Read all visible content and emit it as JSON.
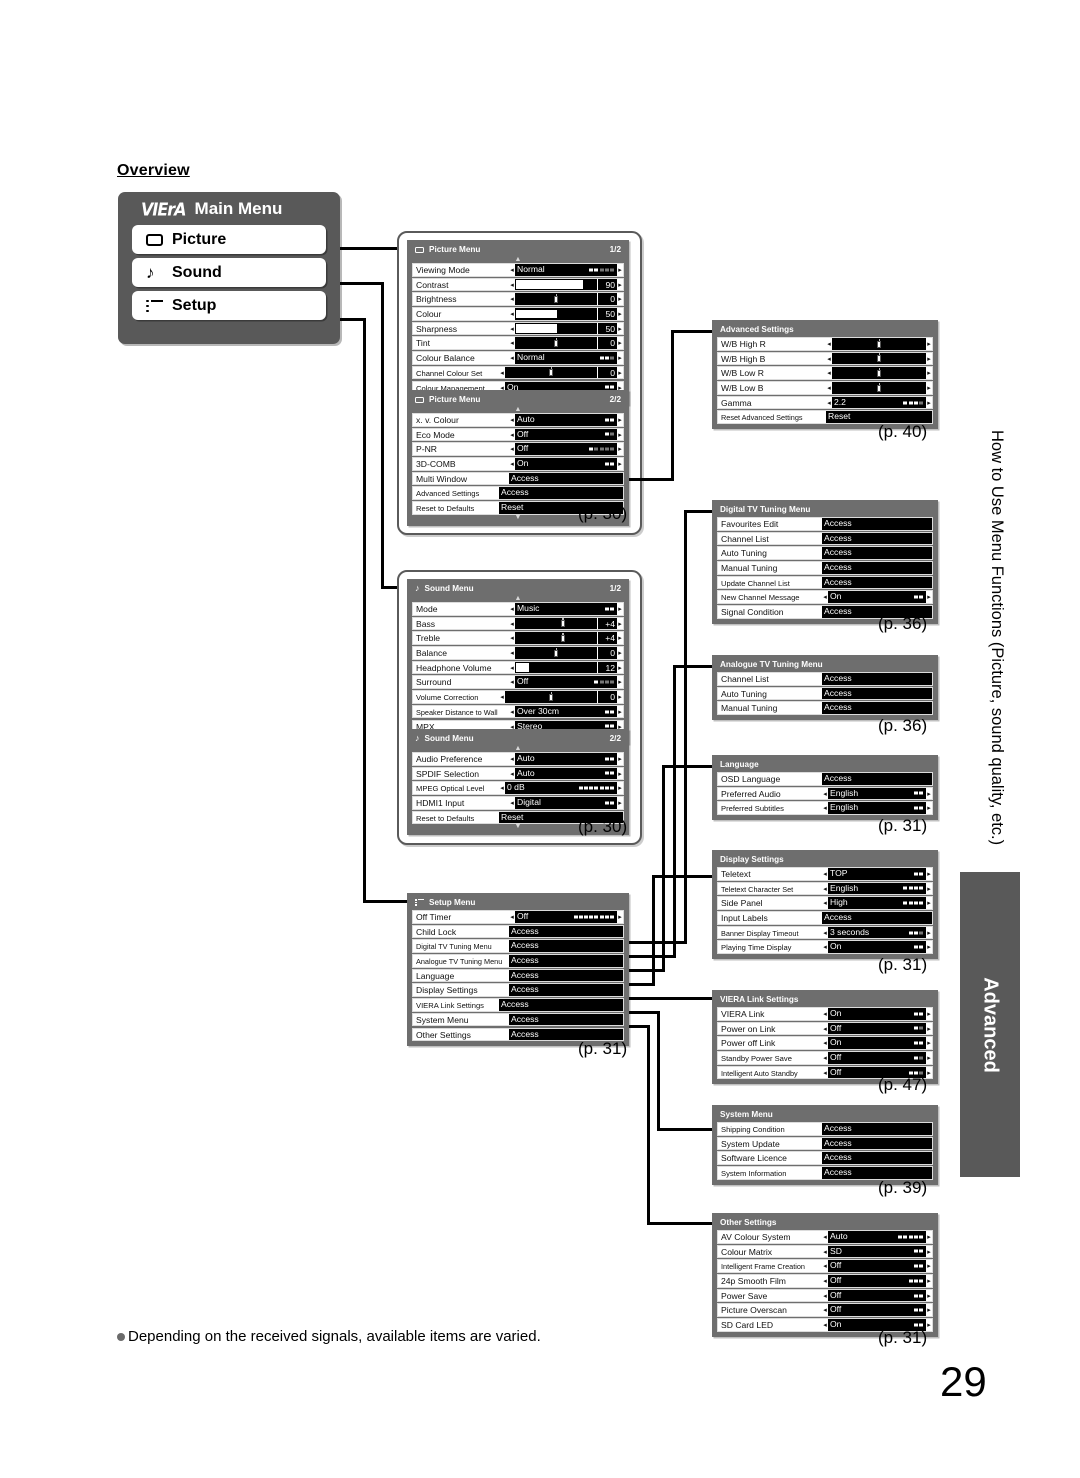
{
  "heading": "Overview",
  "main_menu": {
    "logo": "VIErA",
    "title": "Main Menu",
    "items": [
      {
        "label": "Picture",
        "icon": "picture-icon"
      },
      {
        "label": "Sound",
        "icon": "music-note-icon"
      },
      {
        "label": "Setup",
        "icon": "list-icon"
      }
    ]
  },
  "panels": {
    "picture1": {
      "title": "Picture Menu",
      "page": "1/2",
      "icon": "picture-icon",
      "rows": [
        {
          "label": "Viewing Mode",
          "value": "Normal",
          "type": "option",
          "dots": 5,
          "on": 2
        },
        {
          "label": "Contrast",
          "value": "90",
          "type": "slider",
          "fill": 82
        },
        {
          "label": "Brightness",
          "value": "0",
          "type": "slider",
          "knob": 50
        },
        {
          "label": "Colour",
          "value": "50",
          "type": "slider",
          "fill": 50
        },
        {
          "label": "Sharpness",
          "value": "50",
          "type": "slider",
          "fill": 50
        },
        {
          "label": "Tint",
          "value": "0",
          "type": "slider",
          "knob": 50
        },
        {
          "label": "Colour Balance",
          "value": "Normal",
          "type": "option",
          "dots": 3,
          "on": 2
        },
        {
          "label": "Channel Colour Set",
          "value": "0",
          "type": "slider",
          "knob": 50
        },
        {
          "label": "Colour Management",
          "value": "On",
          "type": "option",
          "dots": 2,
          "on": 2
        }
      ]
    },
    "picture2": {
      "title": "Picture Menu",
      "page": "2/2",
      "icon": "picture-icon",
      "rows": [
        {
          "label": "x. v. Colour",
          "value": "Auto",
          "type": "option",
          "dots": 2,
          "on": 2
        },
        {
          "label": "Eco Mode",
          "value": "Off",
          "type": "option",
          "dots": 2,
          "on": 1
        },
        {
          "label": "P-NR",
          "value": "Off",
          "type": "option",
          "dots": 5,
          "on": 1
        },
        {
          "label": "3D-COMB",
          "value": "On",
          "type": "option",
          "dots": 2,
          "on": 2
        },
        {
          "label": "Multi Window",
          "value": "Access",
          "type": "access"
        },
        {
          "label": "Advanced Settings",
          "value": "Access",
          "type": "access"
        },
        {
          "label": "Reset to Defaults",
          "value": "Reset",
          "type": "access"
        }
      ]
    },
    "sound1": {
      "title": "Sound Menu",
      "page": "1/2",
      "icon": "music-note-icon",
      "rows": [
        {
          "label": "Mode",
          "value": "Music",
          "type": "option",
          "dots": 2,
          "on": 2
        },
        {
          "label": "Bass",
          "value": "+4",
          "type": "slider",
          "knob": 58
        },
        {
          "label": "Treble",
          "value": "+4",
          "type": "slider",
          "knob": 58
        },
        {
          "label": "Balance",
          "value": "0",
          "type": "slider",
          "knob": 50
        },
        {
          "label": "Headphone Volume",
          "value": "12",
          "type": "slider",
          "fill": 16
        },
        {
          "label": "Surround",
          "value": "Off",
          "type": "option",
          "dots": 4,
          "on": 1
        },
        {
          "label": "Volume Correction",
          "value": "0",
          "type": "slider",
          "knob": 50
        },
        {
          "label": "Speaker Distance to Wall",
          "value": "Over 30cm",
          "type": "option",
          "dots": 2,
          "on": 2
        },
        {
          "label": "MPX",
          "value": "Stereo",
          "type": "option",
          "dots": 2,
          "on": 2
        }
      ]
    },
    "sound2": {
      "title": "Sound Menu",
      "page": "2/2",
      "icon": "music-note-icon",
      "rows": [
        {
          "label": "Audio Preference",
          "value": "Auto",
          "type": "option",
          "dots": 2,
          "on": 2
        },
        {
          "label": "SPDIF Selection",
          "value": "Auto",
          "type": "option",
          "dots": 2,
          "on": 2
        },
        {
          "label": "MPEG Optical Level",
          "value": "0 dB",
          "type": "option",
          "dots": 7,
          "on": 7
        },
        {
          "label": "HDMI1 Input",
          "value": "Digital",
          "type": "option",
          "dots": 2,
          "on": 2
        },
        {
          "label": "Reset to Defaults",
          "value": "Reset",
          "type": "access"
        }
      ]
    },
    "setup": {
      "title": "Setup Menu",
      "page": "",
      "icon": "list-icon",
      "rows": [
        {
          "label": "Off Timer",
          "value": "Off",
          "type": "option",
          "dots": 8,
          "on": 8
        },
        {
          "label": "Child Lock",
          "value": "Access",
          "type": "access"
        },
        {
          "label": "Digital TV Tuning Menu",
          "value": "Access",
          "type": "access"
        },
        {
          "label": "Analogue TV Tuning Menu",
          "value": "Access",
          "type": "access"
        },
        {
          "label": "Language",
          "value": "Access",
          "type": "access"
        },
        {
          "label": "Display Settings",
          "value": "Access",
          "type": "access"
        },
        {
          "label": "VIERA Link Settings",
          "value": "Access",
          "type": "access"
        },
        {
          "label": "System Menu",
          "value": "Access",
          "type": "access"
        },
        {
          "label": "Other Settings",
          "value": "Access",
          "type": "access"
        }
      ]
    },
    "advanced": {
      "title": "Advanced Settings",
      "page": "",
      "rows": [
        {
          "label": "W/B High R",
          "value": "",
          "type": "slider",
          "knob": 50
        },
        {
          "label": "W/B High B",
          "value": "",
          "type": "slider",
          "knob": 50
        },
        {
          "label": "W/B Low R",
          "value": "",
          "type": "slider",
          "knob": 50
        },
        {
          "label": "W/B Low B",
          "value": "",
          "type": "slider",
          "knob": 50
        },
        {
          "label": "Gamma",
          "value": "2.2",
          "type": "option",
          "dots": 4,
          "on": 3
        },
        {
          "label": "Reset Advanced Settings",
          "value": "Reset",
          "type": "access"
        }
      ]
    },
    "digital_tuning": {
      "title": "Digital TV Tuning Menu",
      "page": "",
      "rows": [
        {
          "label": "Favourites Edit",
          "value": "Access",
          "type": "access"
        },
        {
          "label": "Channel List",
          "value": "Access",
          "type": "access"
        },
        {
          "label": "Auto Tuning",
          "value": "Access",
          "type": "access"
        },
        {
          "label": "Manual Tuning",
          "value": "Access",
          "type": "access"
        },
        {
          "label": "Update Channel List",
          "value": "Access",
          "type": "access"
        },
        {
          "label": "New Channel Message",
          "value": "On",
          "type": "option",
          "dots": 2,
          "on": 2
        },
        {
          "label": "Signal Condition",
          "value": "Access",
          "type": "access"
        }
      ]
    },
    "analogue_tuning": {
      "title": "Analogue TV Tuning Menu",
      "page": "",
      "rows": [
        {
          "label": "Channel List",
          "value": "Access",
          "type": "access"
        },
        {
          "label": "Auto Tuning",
          "value": "Access",
          "type": "access"
        },
        {
          "label": "Manual Tuning",
          "value": "Access",
          "type": "access"
        }
      ]
    },
    "language": {
      "title": "Language",
      "page": "",
      "rows": [
        {
          "label": "OSD Language",
          "value": "Access",
          "type": "access"
        },
        {
          "label": "Preferred Audio",
          "value": "English",
          "type": "option",
          "dots": 2,
          "on": 2
        },
        {
          "label": "Preferred Subtitles",
          "value": "English",
          "type": "option",
          "dots": 2,
          "on": 2
        }
      ]
    },
    "display": {
      "title": "Display Settings",
      "page": "",
      "rows": [
        {
          "label": "Teletext",
          "value": "TOP",
          "type": "option",
          "dots": 2,
          "on": 2
        },
        {
          "label": "Teletext Character Set",
          "value": "English",
          "type": "option",
          "dots": 4,
          "on": 4
        },
        {
          "label": "Side Panel",
          "value": "High",
          "type": "option",
          "dots": 4,
          "on": 4
        },
        {
          "label": "Input Labels",
          "value": "Access",
          "type": "access"
        },
        {
          "label": "Banner Display Timeout",
          "value": "3 seconds",
          "type": "option",
          "dots": 3,
          "on": 2
        },
        {
          "label": "Playing Time Display",
          "value": "On",
          "type": "option",
          "dots": 2,
          "on": 2
        }
      ]
    },
    "viera_link": {
      "title": "VIERA Link Settings",
      "page": "",
      "rows": [
        {
          "label": "VIERA Link",
          "value": "On",
          "type": "option",
          "dots": 2,
          "on": 2
        },
        {
          "label": "Power on Link",
          "value": "Off",
          "type": "option",
          "dots": 2,
          "on": 1
        },
        {
          "label": "Power off Link",
          "value": "On",
          "type": "option",
          "dots": 2,
          "on": 2
        },
        {
          "label": "Standby Power Save",
          "value": "Off",
          "type": "option",
          "dots": 2,
          "on": 1
        },
        {
          "label": "Intelligent Auto Standby",
          "value": "Off",
          "type": "option",
          "dots": 3,
          "on": 2
        }
      ]
    },
    "system": {
      "title": "System Menu",
      "page": "",
      "rows": [
        {
          "label": "Shipping Condition",
          "value": "Access",
          "type": "access"
        },
        {
          "label": "System Update",
          "value": "Access",
          "type": "access"
        },
        {
          "label": "Software Licence",
          "value": "Access",
          "type": "access"
        },
        {
          "label": "System Information",
          "value": "Access",
          "type": "access"
        }
      ]
    },
    "other": {
      "title": "Other Settings",
      "page": "",
      "rows": [
        {
          "label": "AV Colour System",
          "value": "Auto",
          "type": "option",
          "dots": 5,
          "on": 5
        },
        {
          "label": "Colour Matrix",
          "value": "SD",
          "type": "option",
          "dots": 2,
          "on": 2
        },
        {
          "label": "Intelligent Frame Creation",
          "value": "Off",
          "type": "option",
          "dots": 2,
          "on": 2
        },
        {
          "label": "24p Smooth Film",
          "value": "Off",
          "type": "option",
          "dots": 3,
          "on": 3
        },
        {
          "label": "Power Save",
          "value": "Off",
          "type": "option",
          "dots": 2,
          "on": 2
        },
        {
          "label": "Picture Overscan",
          "value": "Off",
          "type": "option",
          "dots": 2,
          "on": 2
        },
        {
          "label": "SD Card LED",
          "value": "On",
          "type": "option",
          "dots": 2,
          "on": 2
        }
      ]
    }
  },
  "page_refs": {
    "picture": "(p. 30)",
    "sound": "(p. 30)",
    "setup": "(p. 31)",
    "advanced": "(p. 40)",
    "digital_tuning": "(p. 36)",
    "analogue_tuning": "(p. 36)",
    "language": "(p. 31)",
    "display": "(p. 31)",
    "viera_link": "(p. 47)",
    "system": "(p. 39)",
    "other": "(p. 31)"
  },
  "sidebar": {
    "vertical_text": "How to Use Menu Functions (Picture, sound quality, etc.)",
    "tab_label": "Advanced"
  },
  "footnote": "Depending on the received signals, available items are varied.",
  "page_number": "29"
}
